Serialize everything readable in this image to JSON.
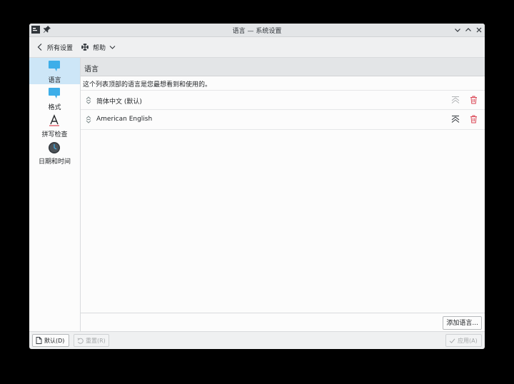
{
  "window": {
    "title": "语言 — 系统设置"
  },
  "toolbar": {
    "back_label": "所有设置",
    "help_label": "帮助"
  },
  "sidebar": {
    "items": [
      {
        "label": "语言",
        "icon": "language-icon",
        "active": true
      },
      {
        "label": "格式",
        "icon": "formats-icon",
        "active": false
      },
      {
        "label": "拼写检查",
        "icon": "spellcheck-icon",
        "active": false
      },
      {
        "label": "日期和时间",
        "icon": "clock-icon",
        "active": false
      }
    ]
  },
  "main": {
    "title": "语言",
    "description": "这个列表顶部的语言是您最想看到和使用的。",
    "languages": [
      {
        "name": "简体中文 (默认)"
      },
      {
        "name": "American English"
      }
    ],
    "add_button": "添加语言..."
  },
  "footer": {
    "defaults_label": "默认(D)",
    "reset_label": "重置(R)",
    "apply_label": "应用(A)"
  },
  "colors": {
    "accent": "#3daee9",
    "active_bg": "#cde6f7",
    "danger": "#da4453"
  }
}
